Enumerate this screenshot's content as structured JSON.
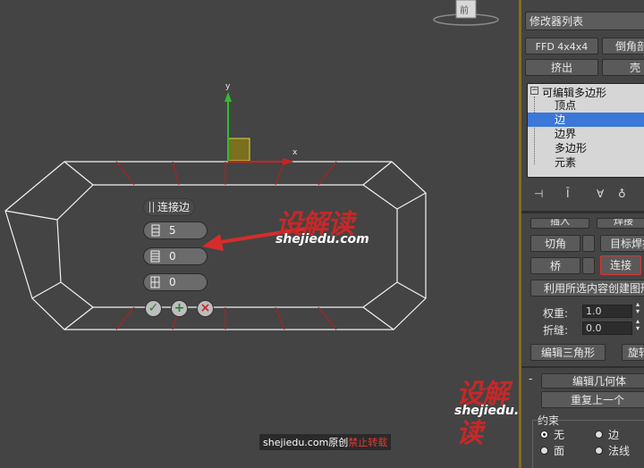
{
  "viewport": {
    "axis_y_label": "y",
    "axis_x_label": "x",
    "caddy": {
      "title": "连接边",
      "fields": [
        {
          "value": "5",
          "icon": "segments-icon"
        },
        {
          "value": "0",
          "icon": "pinch-icon"
        },
        {
          "value": "0",
          "icon": "slide-icon"
        }
      ],
      "buttons": [
        "ok-check-icon",
        "apply-plus-icon",
        "cancel-x-icon"
      ]
    },
    "watermark": {
      "brand": "设解读",
      "url": "shejiedu.com"
    },
    "footer_note": {
      "prefix": "shejiedu.com原创",
      "suffix": "禁止转载"
    },
    "viewcube_label": "前"
  },
  "panel": {
    "modifier_list": "修改器列表",
    "btn_ffd": "FFD 4x4x4",
    "btn_bevel": "倒角剖",
    "btn_extrude": "挤出",
    "btn_shell": "壳",
    "stack": {
      "root": "可编辑多边形",
      "items": [
        "顶点",
        "边",
        "边界",
        "多边形",
        "元素"
      ],
      "selected_index": 1
    },
    "btn_insert_partial": "插入",
    "btn_weld_partial": "焊接",
    "btn_chamfer": "切角",
    "btn_target_weld": "目标焊接",
    "btn_bridge": "桥",
    "btn_connect": "连接",
    "btn_create_shape": "利用所选内容创建图形",
    "weight_label": "权重:",
    "weight_value": "1.0",
    "crease_label": "折缝:",
    "crease_value": "0.0",
    "btn_edit_tri": "编辑三角形",
    "btn_turn": "旋转",
    "rollout_edit_geom": "编辑几何体",
    "btn_repeat_last": "重复上一个",
    "constraints_label": "约束",
    "constraints": [
      "无",
      "边",
      "面",
      "法线"
    ],
    "constraints_selected": "无",
    "colors": {
      "selected": "#3b78d8",
      "highlight_border": "#e03030",
      "accent_border": "#8a6a1a"
    }
  }
}
